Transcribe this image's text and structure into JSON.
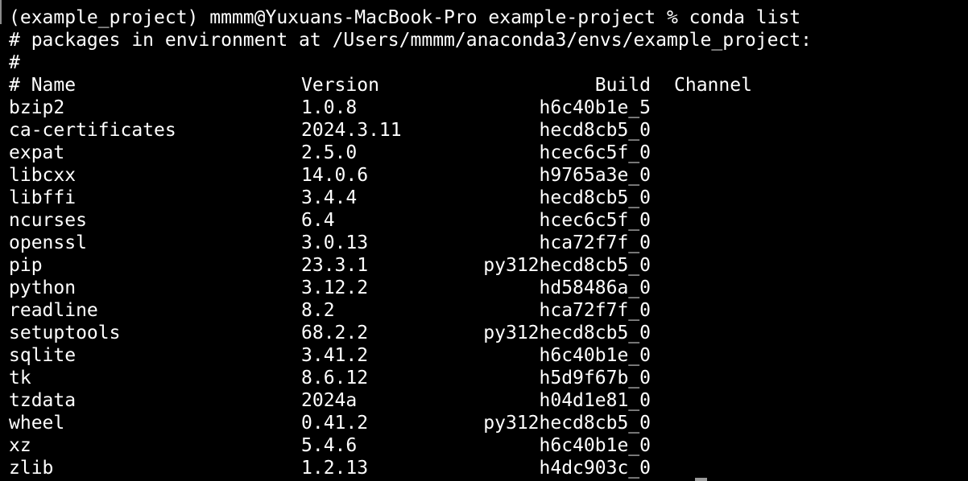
{
  "terminal": {
    "prompt_line": "(example_project) mmmm@Yuxuans-MacBook-Pro example-project % conda list",
    "env_line": "# packages in environment at /Users/mmmm/anaconda3/envs/example_project:",
    "hash_line": "#",
    "header": {
      "name": "# Name",
      "version": "Version",
      "build": "Build",
      "channel": "Channel"
    },
    "packages": [
      {
        "name": "bzip2",
        "version": "1.0.8",
        "build": "h6c40b1e_5"
      },
      {
        "name": "ca-certificates",
        "version": "2024.3.11",
        "build": "hecd8cb5_0"
      },
      {
        "name": "expat",
        "version": "2.5.0",
        "build": "hcec6c5f_0"
      },
      {
        "name": "libcxx",
        "version": "14.0.6",
        "build": "h9765a3e_0"
      },
      {
        "name": "libffi",
        "version": "3.4.4",
        "build": "hecd8cb5_0"
      },
      {
        "name": "ncurses",
        "version": "6.4",
        "build": "hcec6c5f_0"
      },
      {
        "name": "openssl",
        "version": "3.0.13",
        "build": "hca72f7f_0"
      },
      {
        "name": "pip",
        "version": "23.3.1",
        "build": "py312hecd8cb5_0"
      },
      {
        "name": "python",
        "version": "3.12.2",
        "build": "hd58486a_0"
      },
      {
        "name": "readline",
        "version": "8.2",
        "build": "hca72f7f_0"
      },
      {
        "name": "setuptools",
        "version": "68.2.2",
        "build": "py312hecd8cb5_0"
      },
      {
        "name": "sqlite",
        "version": "3.41.2",
        "build": "h6c40b1e_0"
      },
      {
        "name": "tk",
        "version": "8.6.12",
        "build": "h5d9f67b_0"
      },
      {
        "name": "tzdata",
        "version": "2024a",
        "build": "h04d1e81_0"
      },
      {
        "name": "wheel",
        "version": "0.41.2",
        "build": "py312hecd8cb5_0"
      },
      {
        "name": "xz",
        "version": "5.4.6",
        "build": "h6c40b1e_0"
      },
      {
        "name": "zlib",
        "version": "1.2.13",
        "build": "h4dc903c_0"
      }
    ],
    "colors": {
      "background": "#000000",
      "foreground": "#ffffff",
      "cursor": "#9a9a9a"
    }
  }
}
